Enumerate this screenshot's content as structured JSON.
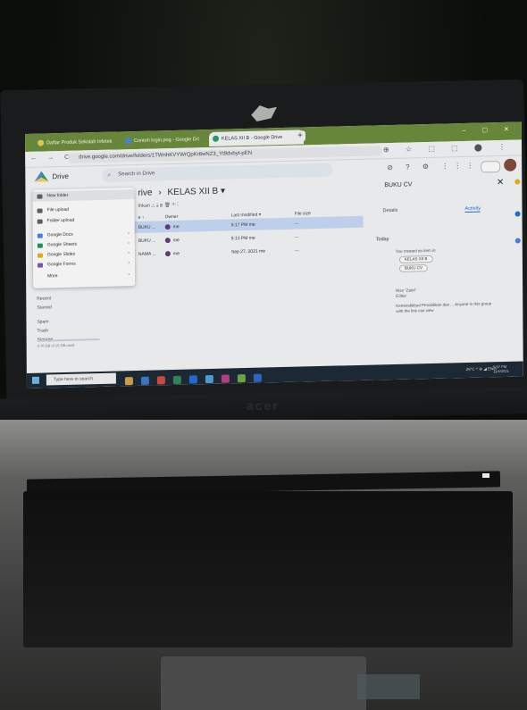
{
  "browser": {
    "tabs": [
      {
        "label": "Daftar Produk Sekolah Infotek"
      },
      {
        "label": "Contoh login.png - Google Dri"
      },
      {
        "label": "KELAS XII B - Google Drive"
      }
    ],
    "new_tab": "+",
    "window_controls": "– ▢ ✕",
    "nav_buttons": "← → C",
    "url": "drive.google.com/drive/folders/1TWnhKVYWrQpKr8wNZ3_Yt9dvbyt-pEN",
    "address_icons": "⊕ ☆ ⬚ ⬚ ⬤ ⋮"
  },
  "drive": {
    "logo_text": "Drive",
    "search_placeholder": "Search in Drive",
    "header_icons": "⊘ ? ⚙ ⋮⋮⋮",
    "breadcrumb_root": "rive",
    "breadcrumb_sep": "›",
    "breadcrumb_current": "KELAS XII B ▾",
    "toolbar": "thkan  ⛬  ⤓  ⊞  🗑  ⚭  ⋮",
    "columns": {
      "name": "e ↑",
      "owner": "Owner",
      "modified": "Last modified ▾",
      "size": "File size"
    },
    "rows": [
      {
        "name": "BUKU ...",
        "owner": "me",
        "modified": "5:17 PM me",
        "size": "—",
        "selected": true
      },
      {
        "name": "BUKU ...",
        "owner": "me",
        "modified": "5:13 PM me",
        "size": "—",
        "selected": false
      },
      {
        "name": "NAMA ...",
        "owner": "me",
        "modified": "Sep 27, 2021 me",
        "size": "—",
        "selected": false
      }
    ],
    "menu": [
      {
        "label": "New folder",
        "icon_color": "#5f6368"
      },
      {
        "label": "File upload",
        "icon_color": "#5f6368"
      },
      {
        "label": "Folder upload",
        "icon_color": "#5f6368"
      },
      {
        "label": "Google Docs",
        "icon_color": "#4285f4"
      },
      {
        "label": "Google Sheets",
        "icon_color": "#0f9d58"
      },
      {
        "label": "Google Slides",
        "icon_color": "#f4b400"
      },
      {
        "label": "Google Forms",
        "icon_color": "#7e57c2"
      },
      {
        "label": "More",
        "icon_color": "#ffffff"
      }
    ],
    "sidebar": [
      "Recent",
      "Starred",
      "Spam",
      "Trash",
      "Storage"
    ],
    "storage_text": "3.70 GB of 15 GB used",
    "details": {
      "title": "BUKU CV",
      "close": "✕",
      "tab_details": "Details",
      "tab_activity": "Activity",
      "today": "Today",
      "activity_1": "You created an item in",
      "chip_folder": "KELAS XII B",
      "chip_file": "BUKU CV",
      "activity_2_name": "Riss \"Zaini\"",
      "activity_2_role": "Editor",
      "activity_3": "Kemendikbud Pendidikan dan ... Anyone in this group with the link can view"
    }
  },
  "taskbar": {
    "search_placeholder": "Type here to search",
    "tray": "29°C  ^ ⊕ ◢ ENG",
    "time": "5:07 PM",
    "date": "11/4/2021"
  },
  "laptop": {
    "brand": "acer"
  }
}
